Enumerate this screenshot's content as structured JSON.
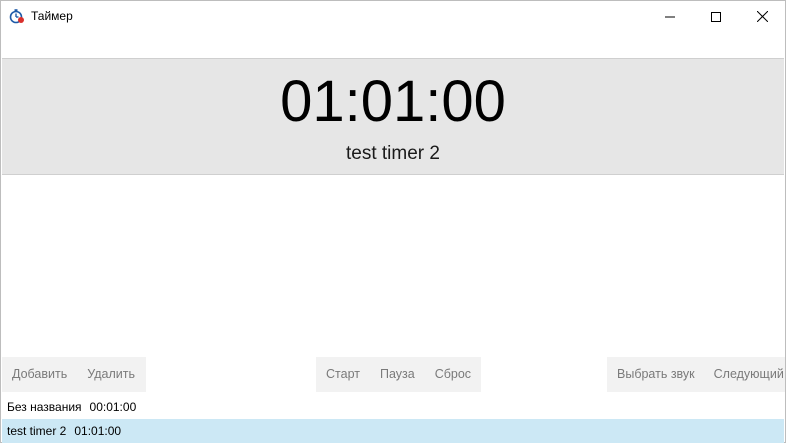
{
  "window": {
    "title": "Таймер",
    "icon": "timer-app-icon",
    "controls": [
      "minimize-icon",
      "maximize-icon",
      "close-icon"
    ]
  },
  "display": {
    "time": "01:01:00",
    "timer_name": "test timer 2"
  },
  "toolbar": {
    "add_label": "Добавить",
    "delete_label": "Удалить",
    "start_label": "Старт",
    "pause_label": "Пауза",
    "reset_label": "Сброс",
    "choose_sound_label": "Выбрать звук",
    "next_label": "Следующий"
  },
  "timers": [
    {
      "name": "Без названия",
      "duration": "00:01:00",
      "selected": false
    },
    {
      "name": "test timer 2",
      "duration": "01:01:00",
      "selected": true
    }
  ],
  "colors": {
    "display_bg": "#e6e6e6",
    "button_group_bg": "#f2f2f2",
    "button_text": "#7a7a7a",
    "selected_row": "#cce8f5"
  }
}
